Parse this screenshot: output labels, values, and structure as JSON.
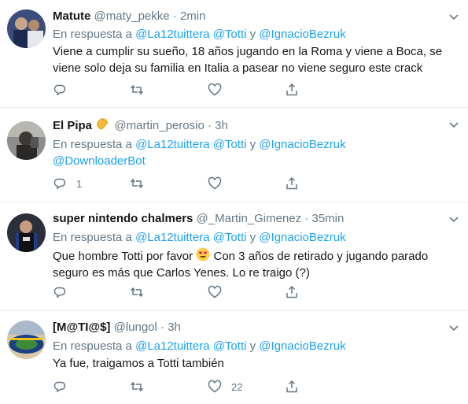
{
  "reply_prefix": "En respuesta a",
  "reply_and": "y",
  "tweets": [
    {
      "name": "Matute",
      "handle": "@maty_pekke",
      "time": "2min",
      "mentions": [
        "@La12tuittera",
        "@Totti",
        "@IgnacioBezruk"
      ],
      "text_line1": "Viene a cumplir su sueño, 18 años jugando en la Roma y viene a Boca, se",
      "text_line2": "viene solo deja su familia en Italia a pasear no viene seguro este crack",
      "reply_count": "",
      "like_count": ""
    },
    {
      "name": "El Pipa",
      "handle": "@martin_perosio",
      "time": "3h",
      "mentions": [
        "@La12tuittera",
        "@Totti",
        "@IgnacioBezruk"
      ],
      "extra_mention": "@DownloaderBot",
      "reply_count": "1",
      "like_count": ""
    },
    {
      "name": "super nintendo chalmers",
      "handle": "@_Martin_Gimenez",
      "time": "35min",
      "mentions": [
        "@La12tuittera",
        "@Totti",
        "@IgnacioBezruk"
      ],
      "text_line1_a": "Que hombre Totti por favor",
      "text_line1_b": "Con 3 años de retirado y jugando parado",
      "text_line2": "seguro es más que Carlos Yenes. Lo re traigo (?)",
      "reply_count": "",
      "like_count": ""
    },
    {
      "name": "[M@TI@$]",
      "handle": "@lungol",
      "time": "3h",
      "mentions": [
        "@La12tuittera",
        "@Totti",
        "@IgnacioBezruk"
      ],
      "text_line1": "Ya fue, traigamos a Totti también",
      "reply_count": "",
      "like_count": "22"
    }
  ],
  "icons": [
    "chevron-down-icon",
    "reply-icon",
    "retweet-icon",
    "like-icon",
    "share-icon",
    "waving-hand-emoji",
    "heart-eyes-emoji"
  ],
  "colors": {
    "link": "#1da1f2",
    "muted": "#657786",
    "text": "#14171a",
    "divider": "#e6ecf0"
  }
}
